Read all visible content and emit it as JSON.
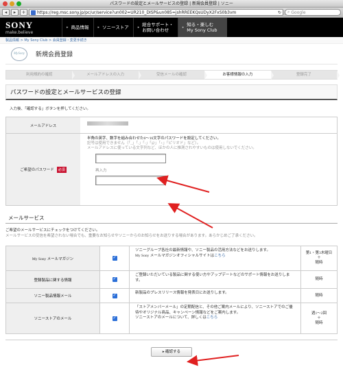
{
  "window": {
    "title": "パスワードの設定とメールサービスの登録 | 新規会員登録 | ソニー"
  },
  "browser": {
    "url": "https://reg.msc.sony.jp/pc/ur/service?un002=UR210_DISP&un085=jshRREEKQsUDyX2FxS0b3vm",
    "search_placeholder": "Google"
  },
  "header": {
    "brand": "SONY",
    "tagline": "make.believe",
    "nav": [
      {
        "label": "商品情報"
      },
      {
        "label": "ソニーストア"
      },
      {
        "label": "総合サポート・\nお問い合わせ"
      },
      {
        "label": "知る・楽しむ\nMy Sony Club"
      }
    ]
  },
  "breadcrumb": {
    "text": "製品情報 > My Sony Club > 会員登録・変更手続き"
  },
  "page": {
    "logo_text": "MySony",
    "title": "新規会員登録"
  },
  "steps": [
    {
      "label": "利用規約の確認"
    },
    {
      "label": "メールアドレスの入力"
    },
    {
      "label": "受信メールの確認"
    },
    {
      "label": "お客様情報の入力"
    },
    {
      "label": "登録完了"
    }
  ],
  "form": {
    "section_title": "パスワードの設定とメールサービスの登録",
    "instruction": "入力後、「確認する」ボタンを押してください。",
    "email_label": "メールアドレス",
    "password_label": "ご希望のパスワード",
    "required": "必須",
    "pw_note": "半角の英字、数字を組み合わせた6〜16文字のパスワードを設定してください。",
    "pw_note2": "記号は使用できません（「_」「.」「-」「@」「+」「ピリオド」など）。",
    "pw_note3": "メールアドレスに使っている文字列など、ほかの人に推測されやすいものは使用しないでください。",
    "reenter_label": "再入力"
  },
  "mail": {
    "heading": "メールサービス",
    "desc1": "ご希望のメールサービスにチェックをつけてください。",
    "desc2": "メールサービスの受信を希望されない場合でも、重要なお知らせやソニーからのお知らせをお送りする場合があります。あらかじめご了承ください。",
    "rows": [
      {
        "name": "My Sony メールマガジン",
        "text": "ソニーグループ各社の最新情報や、ソニー製品の活用方法などをお送りします。",
        "text2": "My Sony メールマガジンオフィシャルサイトは",
        "link": "こちら",
        "freq": "第1・第3木曜日\n＋\n随時"
      },
      {
        "name": "登録製品に関する情報",
        "text": "ご登録いただいている製品に関する使い方やアップデートなどのサポート情報をお送りします。",
        "text2": "",
        "link": "",
        "freq": "随時"
      },
      {
        "name": "ソニー製品情報メール",
        "text": "新製品のプレスリリース情報を発表日にお送りします。",
        "text2": "",
        "link": "",
        "freq": "随時"
      },
      {
        "name": "ソニーストアのメール",
        "text": "「ストアメンバーメール」の定期配信と、その他ご案内メールにより、ソニーストアでのご優待やオリジナル商品、キャンペーン情報などをご案内します。",
        "text2": "ソニーストアのメールについて、詳しくは",
        "link": "こちら",
        "freq": "週1〜2回\n＋\n随時"
      }
    ]
  },
  "confirm_label": "▸ 確認する"
}
